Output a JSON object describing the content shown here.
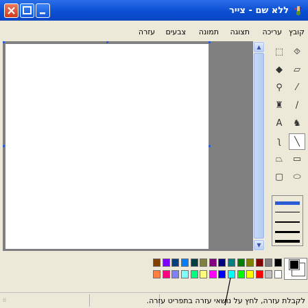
{
  "window": {
    "title": "ללא שם - צייר"
  },
  "menu": {
    "items": [
      "קובץ",
      "עריכה",
      "תצוגה",
      "תמונה",
      "צבעים",
      "עזרה"
    ]
  },
  "tools": [
    {
      "name": "free-form-select-tool",
      "glyph": "⯑"
    },
    {
      "name": "select-tool",
      "glyph": "⬚"
    },
    {
      "name": "eraser-tool",
      "glyph": "▱"
    },
    {
      "name": "fill-tool",
      "glyph": "◆"
    },
    {
      "name": "color-picker-tool",
      "glyph": "⁄"
    },
    {
      "name": "magnifier-tool",
      "glyph": "⚲"
    },
    {
      "name": "pencil-tool",
      "glyph": "/"
    },
    {
      "name": "brush-tool",
      "glyph": "♜"
    },
    {
      "name": "airbrush-tool",
      "glyph": "♞"
    },
    {
      "name": "text-tool",
      "glyph": "A"
    },
    {
      "name": "line-tool",
      "glyph": "╲"
    },
    {
      "name": "curve-tool",
      "glyph": "ʅ"
    },
    {
      "name": "rectangle-tool",
      "glyph": "▭"
    },
    {
      "name": "polygon-tool",
      "glyph": "⏢"
    },
    {
      "name": "ellipse-tool",
      "glyph": "⬭"
    },
    {
      "name": "rounded-rectangle-tool",
      "glyph": "▢"
    }
  ],
  "palette": {
    "top": [
      "#000000",
      "#808080",
      "#800000",
      "#808000",
      "#008000",
      "#008080",
      "#000080",
      "#800080",
      "#808040",
      "#004040",
      "#0080ff",
      "#004080",
      "#8000ff",
      "#804000"
    ],
    "bottom": [
      "#ffffff",
      "#c0c0c0",
      "#ff0000",
      "#ffff00",
      "#00ff00",
      "#00ffff",
      "#0000ff",
      "#ff00ff",
      "#ffff80",
      "#00ff80",
      "#80ffff",
      "#8080ff",
      "#ff0080",
      "#ff8040"
    ],
    "foreground": "#000000",
    "background": "#ffffff"
  },
  "status": {
    "text": "לקבלת עזרה, לחץ על נושאי עזרה בתפריט עזרה."
  }
}
